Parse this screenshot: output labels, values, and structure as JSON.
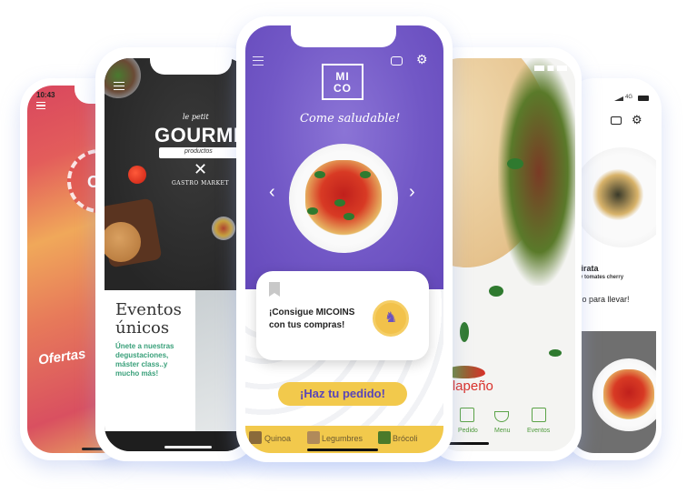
{
  "phones": {
    "ofertas": {
      "status_time": "10:43",
      "badge_text": "OI",
      "banner_label": "Ofertas"
    },
    "gourmet": {
      "logo_small": "le petit",
      "logo_main": "GOURMET",
      "logo_ribbon": "productos",
      "logo_sub": "GASTRO MARKET",
      "events_title_line1": "Eventos",
      "events_title_line2": "únicos",
      "events_desc": [
        "Únete a nuestras",
        "degustaciones,",
        "máster class..y",
        "mucho más!"
      ]
    },
    "mico": {
      "logo_line1": "MI",
      "logo_line2": "CO",
      "tagline": "Come saludable!",
      "card_text_line1": "¡Consigue MICOINS",
      "card_text_line2": "con tus compras!",
      "cta_label": "¡Haz tu pedido!",
      "categories": [
        {
          "label": "Quinoa",
          "color": "#8a6a3a"
        },
        {
          "label": "Legumbres",
          "color": "#b08a5a"
        },
        {
          "label": "Brócoli",
          "color": "#4a7a2a"
        }
      ],
      "colors": {
        "purple": "#7258c6",
        "yellow": "#f2c94c"
      }
    },
    "jalapeno": {
      "brand": "Jalapeño",
      "tabs": [
        {
          "label": "Pedido",
          "icon": "shopping-bag-icon"
        },
        {
          "label": "Menu",
          "icon": "food-bowl-icon"
        },
        {
          "label": "Eventos",
          "icon": "calendar-icon"
        }
      ],
      "brand_color": "#d9302a",
      "tab_color": "#4e9a3c"
    },
    "pirata": {
      "status_network": "4G",
      "dish_title": "s Pirata",
      "dish_desc": "bas y tomates cherry",
      "takeaway_text": "ídelo para llevar!"
    }
  }
}
